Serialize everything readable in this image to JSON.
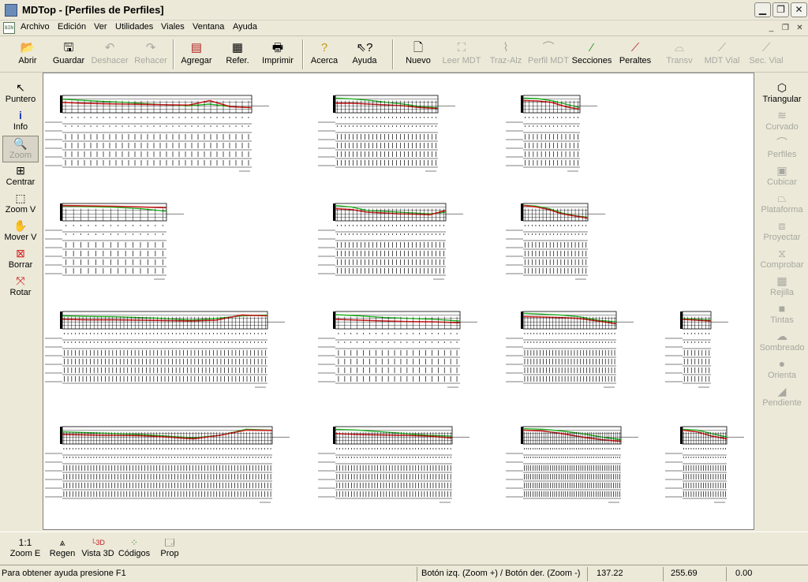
{
  "window": {
    "title": "MDTop - [Perfiles de Perfiles]"
  },
  "menu": {
    "items": [
      "Archivo",
      "Edición",
      "Ver",
      "Utilidades",
      "Viales",
      "Ventana",
      "Ayuda"
    ]
  },
  "toolbar": {
    "buttons": [
      {
        "label": "Abrir",
        "icon": "open-folder-icon",
        "enabled": true
      },
      {
        "label": "Guardar",
        "icon": "floppy-disk-icon",
        "enabled": true
      },
      {
        "label": "Deshacer",
        "icon": "undo-icon",
        "enabled": false
      },
      {
        "label": "Rehacer",
        "icon": "redo-icon",
        "enabled": false
      },
      {
        "label": "Agregar",
        "icon": "add-document-icon",
        "enabled": true
      },
      {
        "label": "Refer.",
        "icon": "reference-icon",
        "enabled": true
      },
      {
        "label": "Imprimir",
        "icon": "printer-icon",
        "enabled": true
      },
      {
        "label": "Acerca",
        "icon": "about-icon",
        "enabled": true
      },
      {
        "label": "Ayuda",
        "icon": "help-pointer-icon",
        "enabled": true
      },
      {
        "label": "Nuevo",
        "icon": "new-document-icon",
        "enabled": true
      },
      {
        "label": "Leer MDT",
        "icon": "read-mdt-icon",
        "enabled": false
      },
      {
        "label": "Traz-Alz",
        "icon": "alignment-icon",
        "enabled": false
      },
      {
        "label": "Perfil MDT",
        "icon": "profile-mdt-icon",
        "enabled": false
      },
      {
        "label": "Secciones",
        "icon": "sections-icon",
        "enabled": true
      },
      {
        "label": "Peraltes",
        "icon": "superelevation-icon",
        "enabled": true
      },
      {
        "label": "Transv",
        "icon": "cross-section-icon",
        "enabled": false
      },
      {
        "label": "MDT Vial",
        "icon": "mdt-road-icon",
        "enabled": false
      },
      {
        "label": "Sec. Vial",
        "icon": "road-section-icon",
        "enabled": false
      }
    ]
  },
  "left_tools": [
    {
      "label": "Puntero",
      "icon": "pointer-arrow-icon",
      "active": false
    },
    {
      "label": "Info",
      "icon": "info-icon",
      "active": false
    },
    {
      "label": "Zoom",
      "icon": "magnifier-icon",
      "active": true
    },
    {
      "label": "Centrar",
      "icon": "center-crosshair-icon",
      "active": false
    },
    {
      "label": "Zoom V",
      "icon": "zoom-window-icon",
      "active": false
    },
    {
      "label": "Mover V",
      "icon": "hand-pan-icon",
      "active": false
    },
    {
      "label": "Borrar",
      "icon": "erase-icon",
      "active": false
    },
    {
      "label": "Rotar",
      "icon": "rotate-icon",
      "active": false
    }
  ],
  "right_tools": [
    {
      "label": "Triangular",
      "icon": "triangulate-icon",
      "enabled": true
    },
    {
      "label": "Curvado",
      "icon": "contour-icon",
      "enabled": false
    },
    {
      "label": "Perfiles",
      "icon": "profiles-icon",
      "enabled": false
    },
    {
      "label": "Cubicar",
      "icon": "volume-cube-icon",
      "enabled": false
    },
    {
      "label": "Plataforma",
      "icon": "platform-icon",
      "enabled": false
    },
    {
      "label": "Proyectar",
      "icon": "project-icon",
      "enabled": false
    },
    {
      "label": "Comprobar",
      "icon": "check-icon",
      "enabled": false
    },
    {
      "label": "Rejilla",
      "icon": "grid-icon",
      "enabled": false
    },
    {
      "label": "Tintas",
      "icon": "ink-fill-icon",
      "enabled": false
    },
    {
      "label": "Sombreado",
      "icon": "shading-icon",
      "enabled": false
    },
    {
      "label": "Orienta",
      "icon": "orientation-sphere-icon",
      "enabled": false
    },
    {
      "label": "Pendiente",
      "icon": "slope-icon",
      "enabled": false
    }
  ],
  "bottom_tools": [
    {
      "label": "Zoom E",
      "icon_text": "1:1",
      "icon": "zoom-extents-icon"
    },
    {
      "label": "Regen",
      "icon": "regen-icon"
    },
    {
      "label": "Vista 3D",
      "icon": "view-3d-icon"
    },
    {
      "label": "Códigos",
      "icon": "codes-grid-icon"
    },
    {
      "label": "Prop",
      "icon": "properties-icon"
    }
  ],
  "status": {
    "help": "Para obtener ayuda presione F1",
    "hint": "Botón izq. (Zoom +) / Botón der. (Zoom -)",
    "x": "137.22",
    "y": "255.69",
    "z": "0.00"
  },
  "colors": {
    "terrain": "#22b022",
    "grade": "#c81e1e",
    "grid": "#000000"
  },
  "drawing": {
    "profile_sheets": [
      {
        "row": 1,
        "col": 1,
        "stations": 30,
        "ground": [
          0.78,
          0.72,
          0.65,
          0.6,
          0.52,
          0.45,
          0.4,
          0.5,
          0.35,
          0.3
        ],
        "grade": [
          0.6,
          0.55,
          0.52,
          0.5,
          0.48,
          0.46,
          0.44,
          0.7,
          0.35,
          0.3
        ]
      },
      {
        "row": 1,
        "col": 2,
        "stations": 26,
        "ground": [
          0.85,
          0.8,
          0.72,
          0.6,
          0.5,
          0.35,
          0.3
        ],
        "grade": [
          0.55,
          0.55,
          0.5,
          0.45,
          0.4,
          0.3,
          0.25
        ]
      },
      {
        "row": 1,
        "col": 3,
        "stations": 14,
        "ground": [
          0.85,
          0.82,
          0.7,
          0.5,
          0.3
        ],
        "grade": [
          0.7,
          0.68,
          0.6,
          0.35,
          0.2
        ]
      },
      {
        "row": 2,
        "col": 1,
        "stations": 14,
        "ground": [
          0.85,
          0.82,
          0.78,
          0.7,
          0.55
        ],
        "grade": [
          0.88,
          0.86,
          0.84,
          0.8,
          0.75
        ]
      },
      {
        "row": 2,
        "col": 2,
        "stations": 28,
        "ground": [
          0.88,
          0.8,
          0.6,
          0.55,
          0.5,
          0.45,
          0.4,
          0.5
        ],
        "grade": [
          0.7,
          0.65,
          0.5,
          0.45,
          0.4,
          0.38,
          0.35,
          0.6
        ]
      },
      {
        "row": 2,
        "col": 3,
        "stations": 18,
        "ground": [
          0.9,
          0.85,
          0.7,
          0.45,
          0.3,
          0.2
        ],
        "grade": [
          0.88,
          0.8,
          0.65,
          0.4,
          0.28,
          0.15
        ]
      },
      {
        "row": 3,
        "col": 1,
        "stations": 55,
        "ground": [
          0.75,
          0.72,
          0.7,
          0.65,
          0.6,
          0.5,
          0.6,
          0.75,
          0.8
        ],
        "grade": [
          0.55,
          0.52,
          0.52,
          0.5,
          0.48,
          0.45,
          0.5,
          0.8,
          0.75
        ]
      },
      {
        "row": 3,
        "col": 2,
        "stations": 20,
        "ground": [
          0.82,
          0.75,
          0.65,
          0.6,
          0.55,
          0.45
        ],
        "grade": [
          0.55,
          0.5,
          0.45,
          0.42,
          0.4,
          0.35
        ]
      },
      {
        "row": 3,
        "col": 3,
        "stations": 30,
        "ground": [
          0.9,
          0.85,
          0.8,
          0.7,
          0.5,
          0.4
        ],
        "grade": [
          0.7,
          0.68,
          0.65,
          0.6,
          0.45,
          0.3
        ]
      },
      {
        "row": 3,
        "col": 4,
        "stations": 8,
        "ground": [
          0.6,
          0.55,
          0.5
        ],
        "grade": [
          0.55,
          0.5,
          0.45
        ]
      },
      {
        "row": 4,
        "col": 1,
        "stations": 70,
        "ground": [
          0.7,
          0.65,
          0.6,
          0.55,
          0.45,
          0.35,
          0.5,
          0.85,
          0.8
        ],
        "grade": [
          0.55,
          0.52,
          0.5,
          0.48,
          0.4,
          0.3,
          0.5,
          0.8,
          0.78
        ]
      },
      {
        "row": 4,
        "col": 2,
        "stations": 40,
        "ground": [
          0.85,
          0.8,
          0.7,
          0.6,
          0.5,
          0.45
        ],
        "grade": [
          0.6,
          0.55,
          0.52,
          0.5,
          0.45,
          0.35
        ]
      },
      {
        "row": 4,
        "col": 3,
        "stations": 45,
        "ground": [
          0.88,
          0.85,
          0.75,
          0.6,
          0.4,
          0.25
        ],
        "grade": [
          0.8,
          0.75,
          0.6,
          0.4,
          0.25,
          0.15
        ]
      },
      {
        "row": 4,
        "col": 4,
        "stations": 18,
        "ground": [
          0.85,
          0.8,
          0.6,
          0.4
        ],
        "grade": [
          0.8,
          0.7,
          0.45,
          0.3
        ]
      }
    ]
  }
}
